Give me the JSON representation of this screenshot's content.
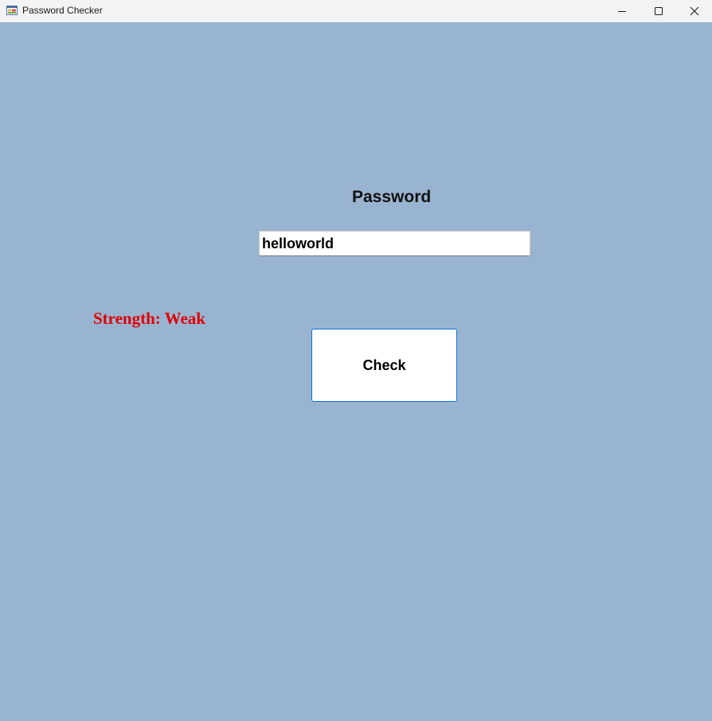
{
  "window": {
    "title": "Password Checker",
    "icons": {
      "app": "app-window-icon",
      "minimize": "minimize-icon",
      "maximize": "maximize-icon",
      "close": "close-icon"
    }
  },
  "form": {
    "password_label": "Password",
    "password_value": "helloworld",
    "strength_text": "Strength: Weak",
    "check_button_label": "Check"
  },
  "colors": {
    "background": "#99b4d1",
    "strength_weak": "#e00000",
    "button_border": "#0a6fd8"
  }
}
